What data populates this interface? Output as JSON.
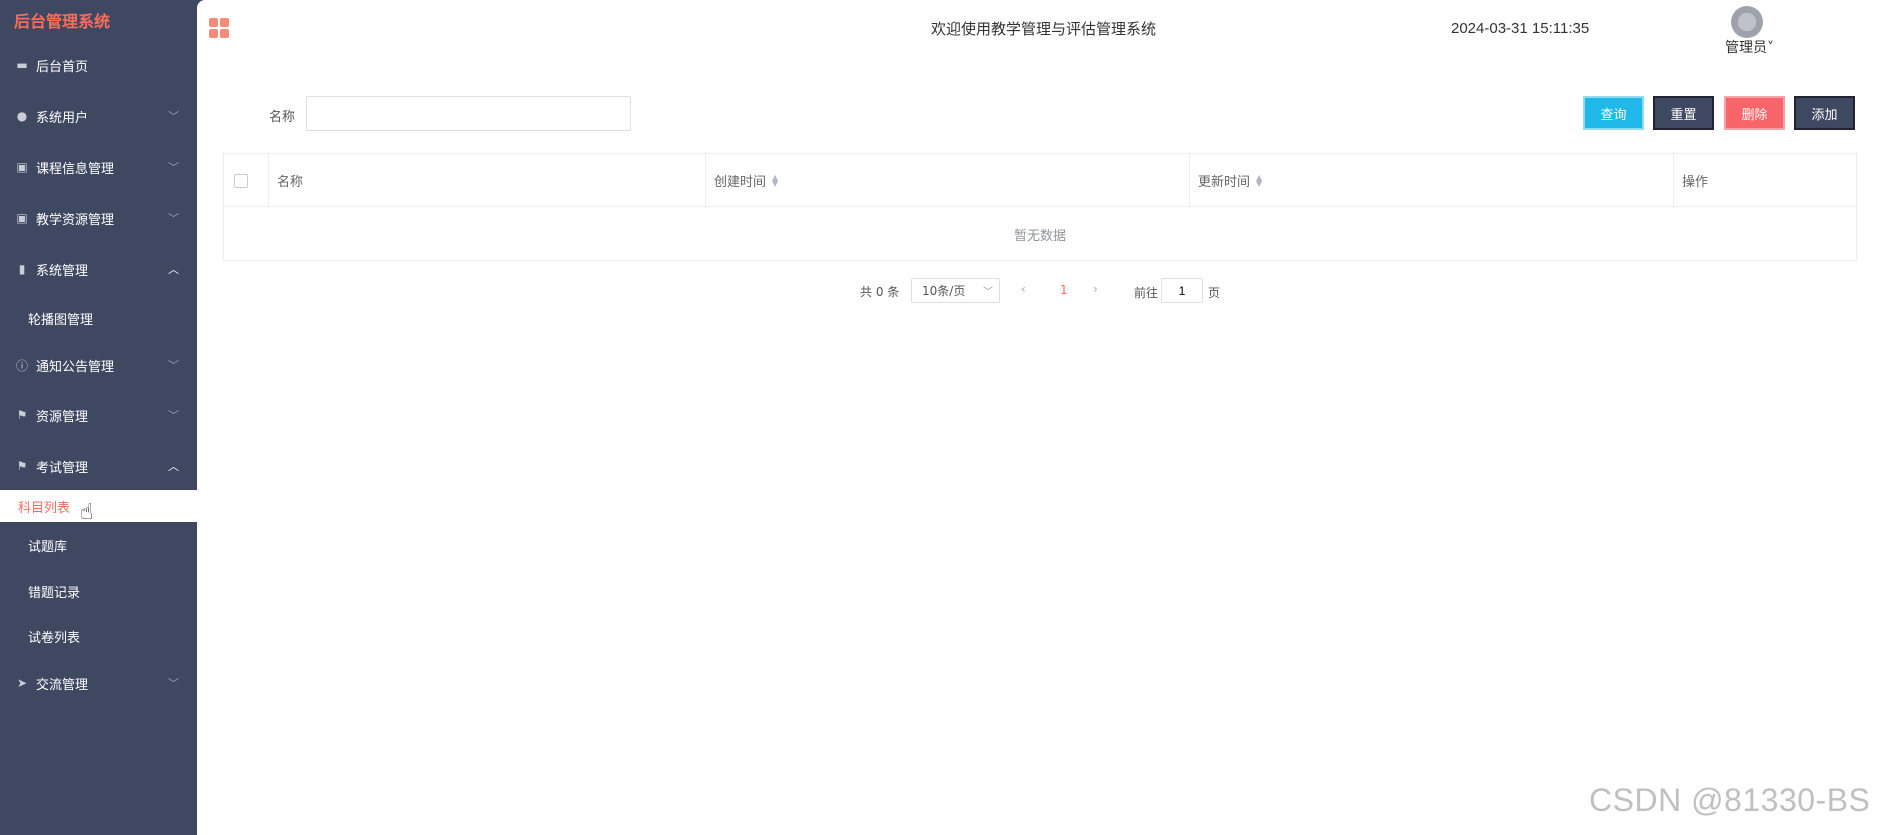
{
  "sidebar": {
    "brand": "后台管理系统",
    "items": [
      {
        "label": "后台首页",
        "icon": "monitor-icon"
      },
      {
        "label": "系统用户",
        "icon": "user-icon"
      },
      {
        "label": "课程信息管理",
        "icon": "chart-icon"
      },
      {
        "label": "教学资源管理",
        "icon": "chart-icon"
      },
      {
        "label": "系统管理",
        "icon": "bar-chart-icon"
      },
      {
        "label": "通知公告管理",
        "icon": "info-icon"
      },
      {
        "label": "资源管理",
        "icon": "flag-icon"
      },
      {
        "label": "考试管理",
        "icon": "flag-icon"
      },
      {
        "label": "交流管理",
        "icon": "send-icon"
      }
    ],
    "sub_system": {
      "label": "轮播图管理"
    },
    "sub_exam": [
      {
        "label": "科目列表"
      },
      {
        "label": "试题库"
      },
      {
        "label": "错题记录"
      },
      {
        "label": "试卷列表"
      }
    ]
  },
  "header": {
    "title": "欢迎使用教学管理与评估管理系统",
    "time": "2024-03-31 15:11:35",
    "user": "管理员˅"
  },
  "filter": {
    "label": "名称",
    "value": ""
  },
  "toolbar": {
    "query": "查询",
    "reset": "重置",
    "delete": "删除",
    "add": "添加"
  },
  "table": {
    "columns": [
      "名称",
      "创建时间",
      "更新时间",
      "操作"
    ],
    "empty": "暂无数据"
  },
  "pagination": {
    "total": "共 0 条",
    "page_size": "10条/页",
    "current": "1",
    "goto_label": "前往",
    "goto_value": "1",
    "goto_suffix": "页"
  },
  "watermark": "CSDN @81330-BS",
  "colors": {
    "sidebar_bg": "#3e4961",
    "accent": "#ff6b5a",
    "query": "#20b8e8",
    "delete": "#f7646a"
  }
}
